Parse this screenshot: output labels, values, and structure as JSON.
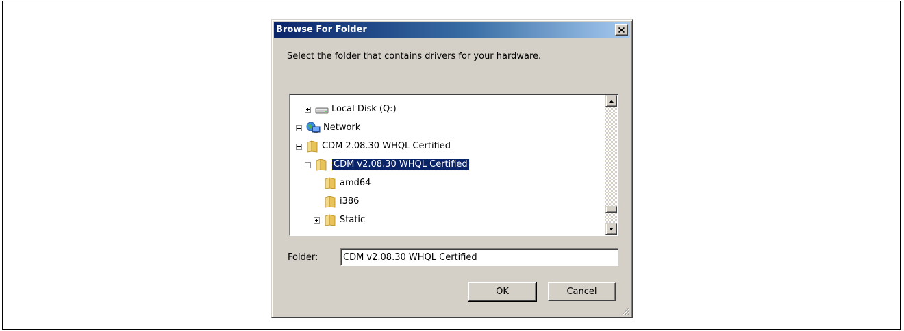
{
  "dialog": {
    "title": "Browse For Folder",
    "close_glyph": "×",
    "instruction": "Select the folder that contains drivers for your hardware."
  },
  "tree": {
    "items": [
      {
        "label": "Local Disk (Q:)",
        "icon": "drive-icon",
        "expander": "plus",
        "selected": false
      },
      {
        "label": "Network",
        "icon": "network-icon",
        "expander": "plus",
        "selected": false
      },
      {
        "label": "CDM 2.08.30 WHQL Certified",
        "icon": "folder-icon",
        "expander": "minus",
        "selected": false
      },
      {
        "label": "CDM v2.08.30 WHQL Certified",
        "icon": "folder-icon",
        "expander": "minus",
        "selected": true
      },
      {
        "label": "amd64",
        "icon": "folder-icon",
        "expander": "none",
        "selected": false
      },
      {
        "label": "i386",
        "icon": "folder-icon",
        "expander": "none",
        "selected": false
      },
      {
        "label": "Static",
        "icon": "folder-icon",
        "expander": "plus",
        "selected": false
      }
    ]
  },
  "folder": {
    "label_prefix": "F",
    "label_rest": "older:",
    "value": "CDM v2.08.30 WHQL Certified"
  },
  "buttons": {
    "ok": "OK",
    "cancel": "Cancel"
  },
  "colors": {
    "title_start": "#0a246a",
    "title_end": "#a6caf0",
    "selection": "#0a246a",
    "dialog_face": "#d4d0c8",
    "folder": "#e8c35a"
  }
}
